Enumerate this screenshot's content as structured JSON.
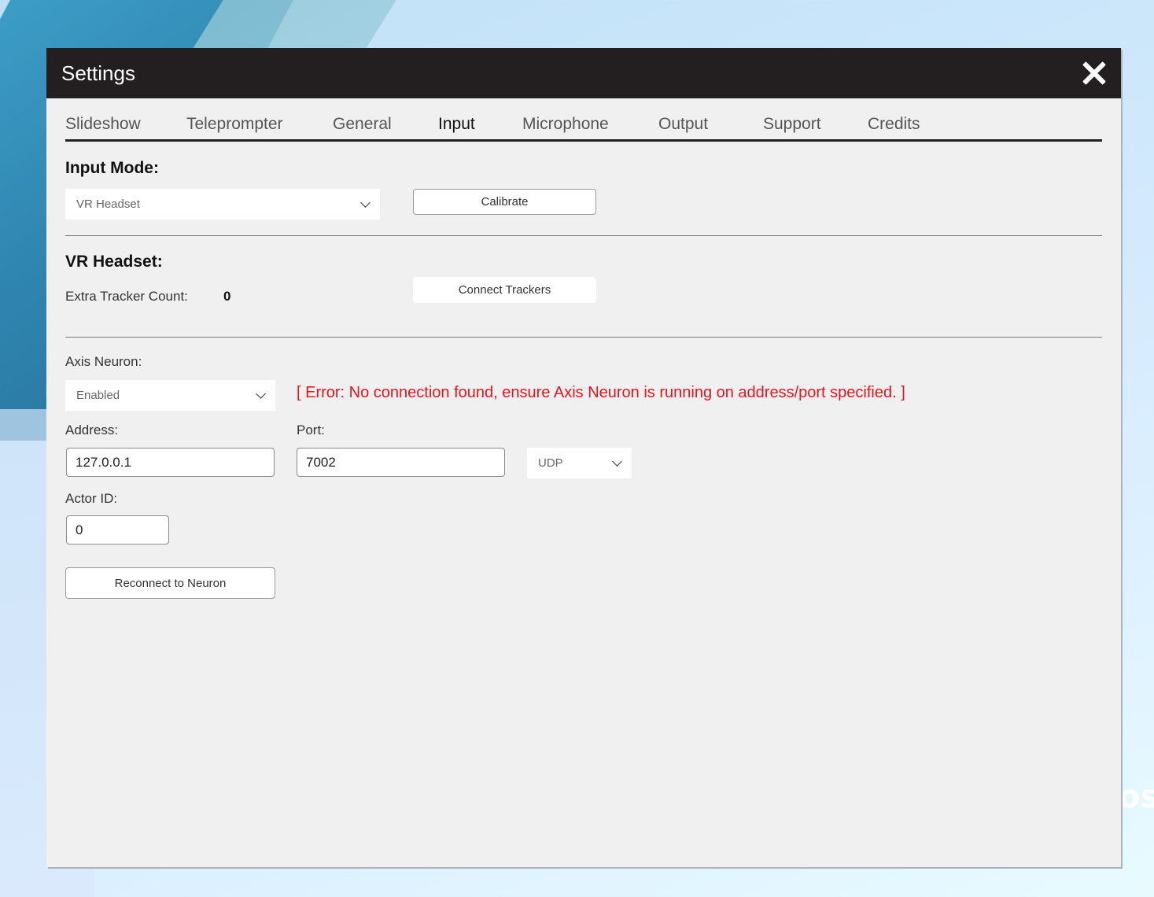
{
  "dialog": {
    "title": "Settings",
    "close_icon": "close-icon"
  },
  "tabs": [
    {
      "label": "Slideshow",
      "active": false
    },
    {
      "label": "Teleprompter",
      "active": false
    },
    {
      "label": "General",
      "active": false
    },
    {
      "label": "Input",
      "active": true
    },
    {
      "label": "Microphone",
      "active": false
    },
    {
      "label": "Output",
      "active": false
    },
    {
      "label": "Support",
      "active": false
    },
    {
      "label": "Credits",
      "active": false
    }
  ],
  "input_mode": {
    "heading": "Input Mode:",
    "selected": "VR Headset",
    "calibrate_label": "Calibrate"
  },
  "vr_headset": {
    "heading": "VR Headset:",
    "tracker_count_label": "Extra Tracker Count:",
    "tracker_count_value": "0",
    "connect_label": "Connect Trackers"
  },
  "axis_neuron": {
    "label": "Axis Neuron:",
    "selected": "Enabled",
    "error": "[ Error: No connection found, ensure Axis Neuron is running on address/port specified. ]",
    "address_label": "Address:",
    "address_value": "127.0.0.1",
    "port_label": "Port:",
    "port_value": "7002",
    "protocol_selected": "UDP",
    "actor_id_label": "Actor ID:",
    "actor_id_value": "0",
    "reconnect_label": "Reconnect to Neuron"
  },
  "background": {
    "partial_text": "os"
  },
  "colors": {
    "titlebar": "#231f20",
    "panel": "#f0f0f0",
    "error": "#e8141c"
  }
}
